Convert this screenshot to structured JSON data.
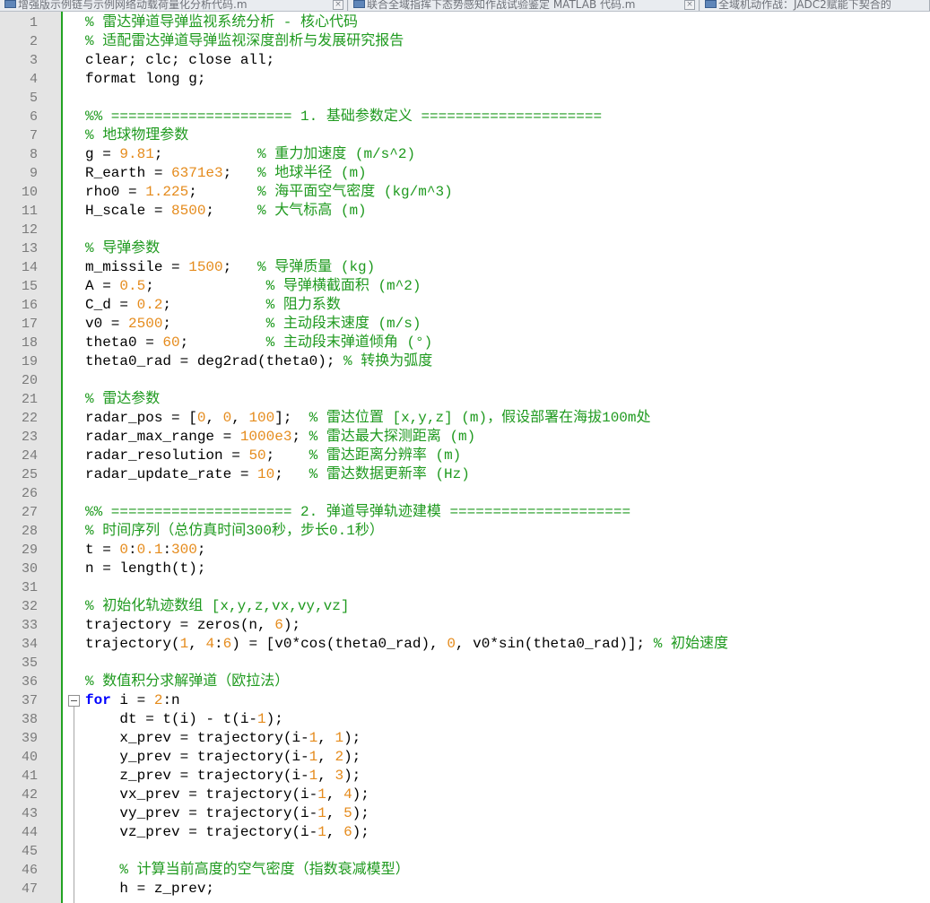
{
  "tabs": [
    {
      "label": "增强版示例链与示例网络动载荷量化分析代码.m"
    },
    {
      "label": "联合全域指挥下态势感知作战试验鉴定 MATLAB 代码.m"
    },
    {
      "label": "全域机动作战：JADC2赋能下契合的"
    }
  ],
  "editor": {
    "line_count": 47,
    "fold_marker": "minus-box",
    "lines": [
      [
        [
          "c",
          "% 雷达弹道导弹监视系统分析 - 核心代码"
        ]
      ],
      [
        [
          "c",
          "% 适配雷达弹道导弹监视深度剖析与发展研究报告"
        ]
      ],
      [
        [
          "",
          "clear; clc; close all;"
        ]
      ],
      [
        [
          "",
          "format long g;"
        ]
      ],
      [],
      [
        [
          "c",
          "%% ===================== 1. 基础参数定义 ====================="
        ]
      ],
      [
        [
          "c",
          "% 地球物理参数"
        ]
      ],
      [
        [
          "",
          "g = "
        ],
        [
          "n",
          "9.81"
        ],
        [
          "",
          ";           "
        ],
        [
          "c",
          "% 重力加速度 (m/s^2)"
        ]
      ],
      [
        [
          "",
          "R_earth = "
        ],
        [
          "n",
          "6371e3"
        ],
        [
          "",
          ";   "
        ],
        [
          "c",
          "% 地球半径 (m)"
        ]
      ],
      [
        [
          "",
          "rho0 = "
        ],
        [
          "n",
          "1.225"
        ],
        [
          "",
          ";       "
        ],
        [
          "c",
          "% 海平面空气密度 (kg/m^3)"
        ]
      ],
      [
        [
          "",
          "H_scale = "
        ],
        [
          "n",
          "8500"
        ],
        [
          "",
          ";     "
        ],
        [
          "c",
          "% 大气标高 (m)"
        ]
      ],
      [],
      [
        [
          "c",
          "% 导弹参数"
        ]
      ],
      [
        [
          "",
          "m_missile = "
        ],
        [
          "n",
          "1500"
        ],
        [
          "",
          ";   "
        ],
        [
          "c",
          "% 导弹质量 (kg)"
        ]
      ],
      [
        [
          "",
          "A = "
        ],
        [
          "n",
          "0.5"
        ],
        [
          "",
          ";             "
        ],
        [
          "c",
          "% 导弹横截面积 (m^2)"
        ]
      ],
      [
        [
          "",
          "C_d = "
        ],
        [
          "n",
          "0.2"
        ],
        [
          "",
          ";           "
        ],
        [
          "c",
          "% 阻力系数"
        ]
      ],
      [
        [
          "",
          "v0 = "
        ],
        [
          "n",
          "2500"
        ],
        [
          "",
          ";           "
        ],
        [
          "c",
          "% 主动段末速度 (m/s)"
        ]
      ],
      [
        [
          "",
          "theta0 = "
        ],
        [
          "n",
          "60"
        ],
        [
          "",
          ";         "
        ],
        [
          "c",
          "% 主动段末弹道倾角 (°)"
        ]
      ],
      [
        [
          "",
          "theta0_rad = deg2rad(theta0); "
        ],
        [
          "c",
          "% 转换为弧度"
        ]
      ],
      [],
      [
        [
          "c",
          "% 雷达参数"
        ]
      ],
      [
        [
          "",
          "radar_pos = ["
        ],
        [
          "n",
          "0"
        ],
        [
          "",
          ", "
        ],
        [
          "n",
          "0"
        ],
        [
          "",
          ", "
        ],
        [
          "n",
          "100"
        ],
        [
          "",
          "];  "
        ],
        [
          "c",
          "% 雷达位置 [x,y,z] (m)，假设部署在海拔100m处"
        ]
      ],
      [
        [
          "",
          "radar_max_range = "
        ],
        [
          "n",
          "1000e3"
        ],
        [
          "",
          "; "
        ],
        [
          "c",
          "% 雷达最大探测距离 (m)"
        ]
      ],
      [
        [
          "",
          "radar_resolution = "
        ],
        [
          "n",
          "50"
        ],
        [
          "",
          ";    "
        ],
        [
          "c",
          "% 雷达距离分辨率 (m)"
        ]
      ],
      [
        [
          "",
          "radar_update_rate = "
        ],
        [
          "n",
          "10"
        ],
        [
          "",
          ";   "
        ],
        [
          "c",
          "% 雷达数据更新率 (Hz)"
        ]
      ],
      [],
      [
        [
          "c",
          "%% ===================== 2. 弹道导弹轨迹建模 ====================="
        ]
      ],
      [
        [
          "c",
          "% 时间序列（总仿真时间300秒，步长0.1秒）"
        ]
      ],
      [
        [
          "",
          "t = "
        ],
        [
          "n",
          "0"
        ],
        [
          "",
          ":"
        ],
        [
          "n",
          "0.1"
        ],
        [
          "",
          ":"
        ],
        [
          "n",
          "300"
        ],
        [
          "",
          ";"
        ]
      ],
      [
        [
          "",
          "n = length(t);"
        ]
      ],
      [],
      [
        [
          "c",
          "% 初始化轨迹数组 [x,y,z,vx,vy,vz]"
        ]
      ],
      [
        [
          "",
          "trajectory = zeros(n, "
        ],
        [
          "n",
          "6"
        ],
        [
          "",
          ");"
        ]
      ],
      [
        [
          "",
          "trajectory("
        ],
        [
          "n",
          "1"
        ],
        [
          "",
          ", "
        ],
        [
          "n",
          "4"
        ],
        [
          "",
          ":"
        ],
        [
          "n",
          "6"
        ],
        [
          "",
          ") = [v0*cos(theta0_rad), "
        ],
        [
          "n",
          "0"
        ],
        [
          "",
          ", v0*sin(theta0_rad)]; "
        ],
        [
          "c",
          "% 初始速度"
        ]
      ],
      [],
      [
        [
          "c",
          "% 数值积分求解弹道（欧拉法）"
        ]
      ],
      [
        [
          "k",
          "for"
        ],
        [
          "",
          " i = "
        ],
        [
          "n",
          "2"
        ],
        [
          "",
          ":n"
        ]
      ],
      [
        [
          "",
          "    dt = t(i) - t(i-"
        ],
        [
          "n",
          "1"
        ],
        [
          "",
          ");"
        ]
      ],
      [
        [
          "",
          "    x_prev = trajectory(i-"
        ],
        [
          "n",
          "1"
        ],
        [
          "",
          ", "
        ],
        [
          "n",
          "1"
        ],
        [
          "",
          ");"
        ]
      ],
      [
        [
          "",
          "    y_prev = trajectory(i-"
        ],
        [
          "n",
          "1"
        ],
        [
          "",
          ", "
        ],
        [
          "n",
          "2"
        ],
        [
          "",
          ");"
        ]
      ],
      [
        [
          "",
          "    z_prev = trajectory(i-"
        ],
        [
          "n",
          "1"
        ],
        [
          "",
          ", "
        ],
        [
          "n",
          "3"
        ],
        [
          "",
          ");"
        ]
      ],
      [
        [
          "",
          "    vx_prev = trajectory(i-"
        ],
        [
          "n",
          "1"
        ],
        [
          "",
          ", "
        ],
        [
          "n",
          "4"
        ],
        [
          "",
          ");"
        ]
      ],
      [
        [
          "",
          "    vy_prev = trajectory(i-"
        ],
        [
          "n",
          "1"
        ],
        [
          "",
          ", "
        ],
        [
          "n",
          "5"
        ],
        [
          "",
          ");"
        ]
      ],
      [
        [
          "",
          "    vz_prev = trajectory(i-"
        ],
        [
          "n",
          "1"
        ],
        [
          "",
          ", "
        ],
        [
          "n",
          "6"
        ],
        [
          "",
          ");"
        ]
      ],
      [],
      [
        [
          "",
          "    "
        ],
        [
          "c",
          "% 计算当前高度的空气密度（指数衰减模型）"
        ]
      ],
      [
        [
          "",
          "    h = z_prev;"
        ]
      ]
    ]
  }
}
